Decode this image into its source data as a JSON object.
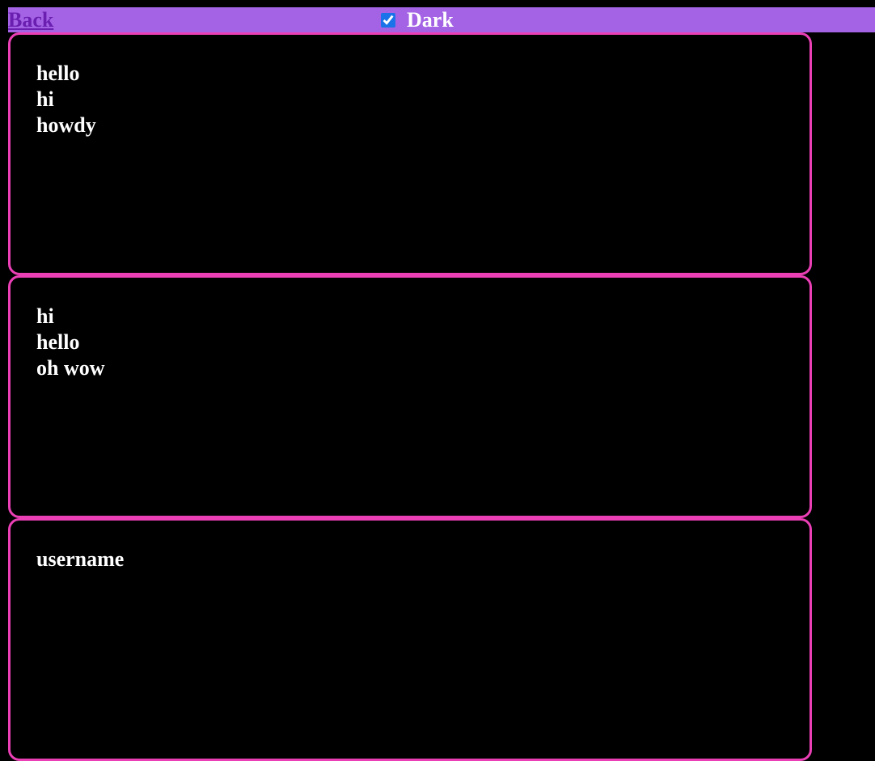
{
  "header": {
    "back_label": "Back",
    "dark_label": "Dark",
    "dark_checked": true
  },
  "cards": [
    {
      "lines": [
        "hello",
        "hi",
        "howdy"
      ]
    },
    {
      "lines": [
        "hi",
        "hello",
        "oh wow"
      ]
    },
    {
      "lines": [
        "username"
      ]
    }
  ],
  "colors": {
    "header_bg": "#a463e5",
    "back_link": "#6a1fb0",
    "card_border": "#ea3fb5",
    "page_bg": "#000000",
    "text": "#ffffff"
  },
  "icons": {
    "checkbox": "checkbox-checked-icon"
  }
}
